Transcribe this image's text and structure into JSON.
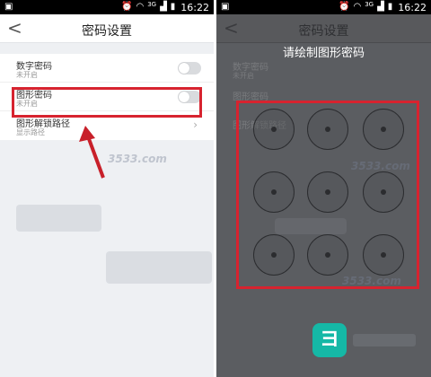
{
  "status": {
    "time": "16:22",
    "net": "3G",
    "icons": [
      "image-icon",
      "alarm-icon",
      "wifi-icon",
      "signal-icon",
      "battery-icon"
    ]
  },
  "left": {
    "back": "<",
    "title": "密码设置",
    "rows": [
      {
        "title": "数字密码",
        "sub": "未开启",
        "toggle_on": false
      },
      {
        "title": "图形密码",
        "sub": "未开启",
        "toggle_on": false
      },
      {
        "title": "图形解锁路径",
        "sub": "显示路径"
      }
    ],
    "chev": "›",
    "colors": {
      "highlight": "#d7232f",
      "arrow": "#c8202a"
    }
  },
  "right": {
    "back": "<",
    "title": "密码设置",
    "overlay_title": "请绘制图形密码",
    "ghost": [
      "数字密码",
      "未开启",
      "图形密码",
      "图形解锁路径"
    ],
    "logo_glyph": "ヨ",
    "logo_color": "#15b8a6"
  },
  "watermark": "3533.com"
}
